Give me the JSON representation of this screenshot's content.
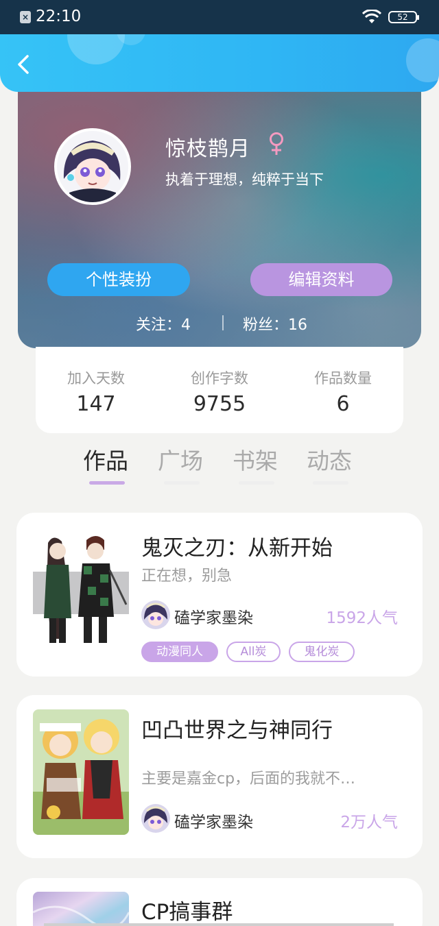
{
  "status_bar": {
    "time": "22:10",
    "battery": "52",
    "notification_icon": "close-box-icon"
  },
  "header": {
    "back_icon": "chevron-left-icon"
  },
  "profile": {
    "username": "惊枝鹊月",
    "gender_symbol": "♀",
    "bio": "执着于理想，纯粹于当下",
    "dress_button": "个性装扮",
    "edit_button": "编辑资料",
    "following": "关注：4",
    "fans": "粉丝：16"
  },
  "stats": [
    {
      "label": "加入天数",
      "value": "147"
    },
    {
      "label": "创作字数",
      "value": "9755"
    },
    {
      "label": "作品数量",
      "value": "6"
    }
  ],
  "tabs": [
    {
      "label": "作品",
      "active": true
    },
    {
      "label": "广场",
      "active": false
    },
    {
      "label": "书架",
      "active": false
    },
    {
      "label": "动态",
      "active": false
    }
  ],
  "works": [
    {
      "title": "鬼灭之刃：从新开始",
      "desc": "正在想，别急",
      "author": "磕学家墨染",
      "popularity": "1592人气",
      "tags": [
        "动漫同人",
        "All炭",
        "鬼化炭"
      ]
    },
    {
      "title": "凹凸世界之与神同行",
      "desc": "主要是嘉金cp，后面的我就不…",
      "author": "磕学家墨染",
      "popularity": "2万人气",
      "tags": []
    },
    {
      "title": "CP搞事群",
      "desc": "",
      "author": "",
      "popularity": "",
      "tags": []
    }
  ],
  "colors": {
    "accent_blue": "#2fa6f0",
    "accent_purple": "#b995e0",
    "tag_purple": "#c9a5e8"
  }
}
